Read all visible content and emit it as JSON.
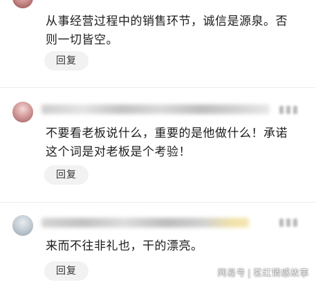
{
  "comments": [
    {
      "text": "从事经营过程中的销售环节，诚信是源泉。否则一切皆空。",
      "reply_label": "回复"
    },
    {
      "text": "不要看老板说什么，重要的是他做什么！承诺这个词是对老板是个考验！",
      "reply_label": "回复"
    },
    {
      "text": "来而不往非礼也，干的漂亮。",
      "reply_label": "回复"
    }
  ],
  "watermark": {
    "source": "网易号",
    "separator": "|",
    "account": "茗红情感故事"
  },
  "colors": {
    "reply_bg": "#f2f2f2",
    "divider": "#ededed",
    "text": "#1c1c1c"
  }
}
